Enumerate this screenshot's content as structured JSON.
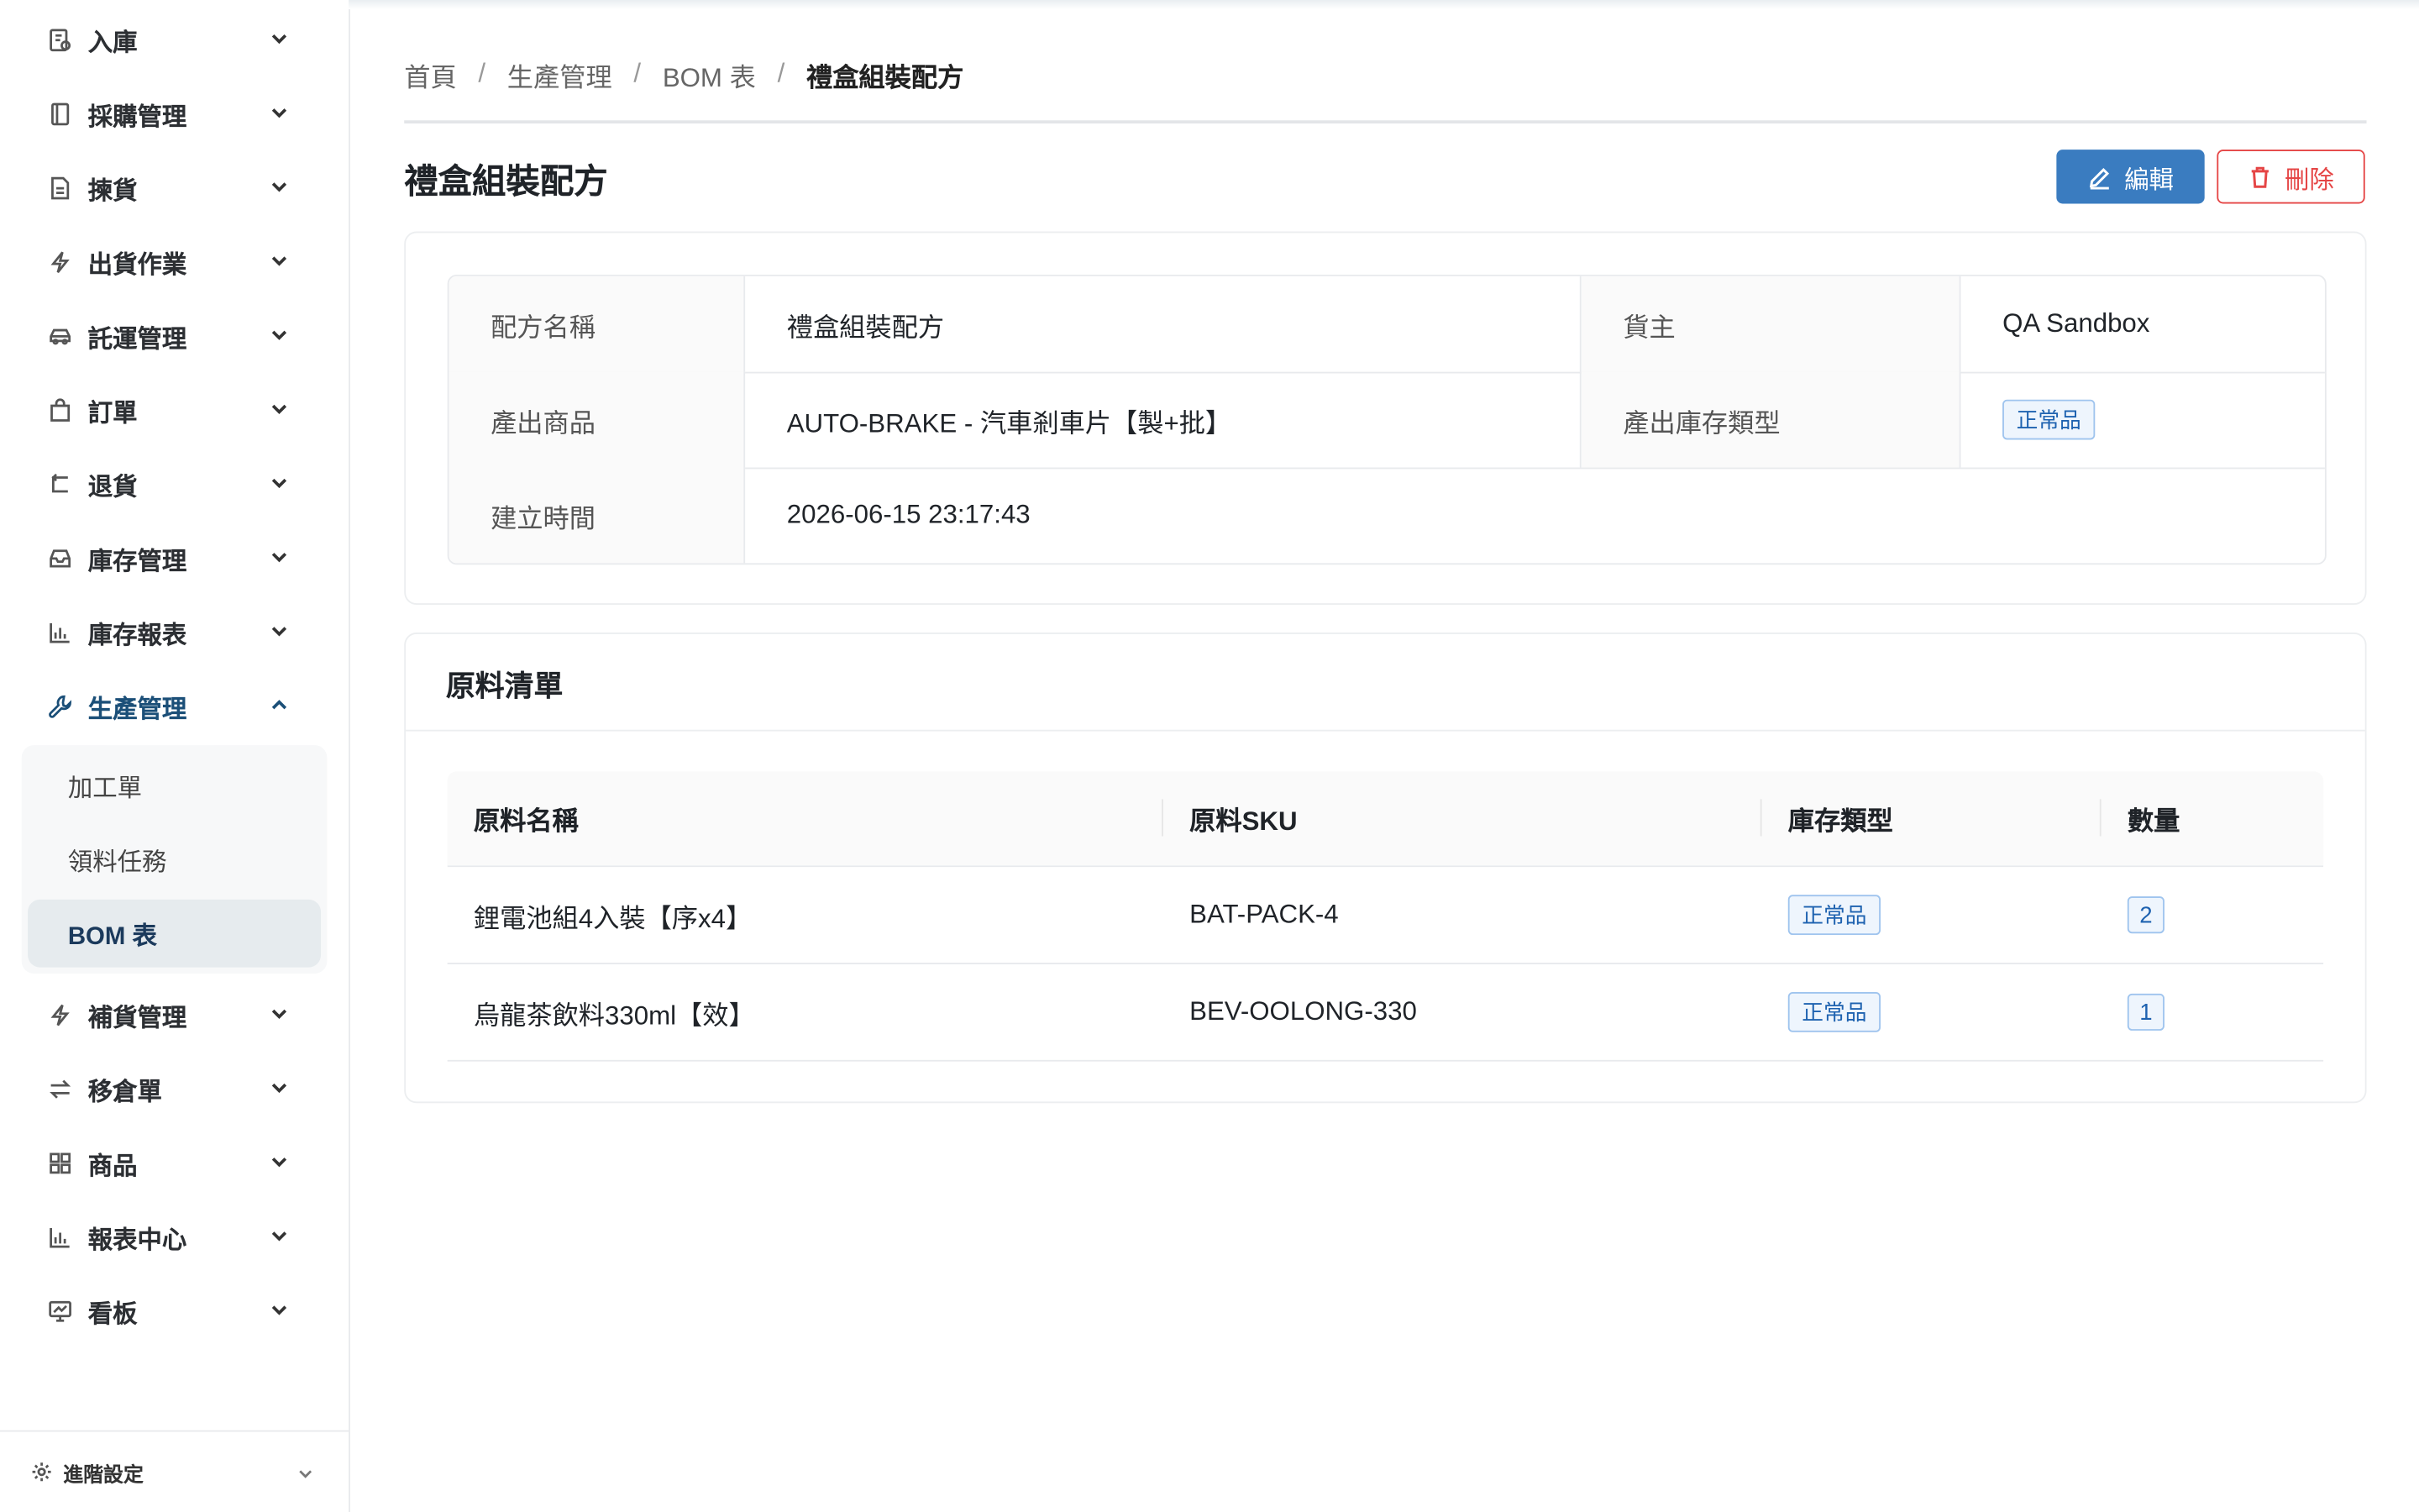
{
  "sidebar": {
    "items": [
      {
        "label": "入庫",
        "icon": "inbound-doc-icon"
      },
      {
        "label": "採購管理",
        "icon": "book-icon"
      },
      {
        "label": "揀貨",
        "icon": "document-icon"
      },
      {
        "label": "出貨作業",
        "icon": "lightning-icon"
      },
      {
        "label": "託運管理",
        "icon": "car-icon"
      },
      {
        "label": "訂單",
        "icon": "shopping-bag-icon"
      },
      {
        "label": "退貨",
        "icon": "return-icon"
      },
      {
        "label": "庫存管理",
        "icon": "inbox-icon"
      },
      {
        "label": "庫存報表",
        "icon": "bar-chart-icon"
      },
      {
        "label": "生產管理",
        "icon": "wrench-icon",
        "expanded": true
      },
      {
        "label": "補貨管理",
        "icon": "lightning-icon"
      },
      {
        "label": "移倉單",
        "icon": "transfer-icon"
      },
      {
        "label": "商品",
        "icon": "grid-icon"
      },
      {
        "label": "報表中心",
        "icon": "bar-chart-icon"
      },
      {
        "label": "看板",
        "icon": "dashboard-icon"
      }
    ],
    "submenu": [
      {
        "label": "加工單"
      },
      {
        "label": "領料任務"
      },
      {
        "label": "BOM 表",
        "selected": true
      }
    ],
    "footer": {
      "label": "進階設定"
    }
  },
  "breadcrumb": {
    "items": [
      "首頁",
      "生產管理",
      "BOM 表"
    ],
    "current": "禮盒組裝配方"
  },
  "page": {
    "title": "禮盒組裝配方",
    "edit_label": "編輯",
    "delete_label": "刪除"
  },
  "info": {
    "recipe_name_label": "配方名稱",
    "recipe_name": "禮盒組裝配方",
    "owner_label": "貨主",
    "owner": "QA Sandbox",
    "output_product_label": "產出商品",
    "output_product": "AUTO-BRAKE - 汽車剎車片【製+批】",
    "output_stock_type_label": "產出庫存類型",
    "output_stock_type": "正常品",
    "created_label": "建立時間",
    "created": "2026-06-15 23:17:43"
  },
  "materials": {
    "title": "原料清單",
    "headers": [
      "原料名稱",
      "原料SKU",
      "庫存類型",
      "數量"
    ],
    "rows": [
      {
        "name": "鋰電池組4入裝【序x4】",
        "sku": "BAT-PACK-4",
        "stock_type": "正常品",
        "qty": "2"
      },
      {
        "name": "烏龍茶飲料330ml【效】",
        "sku": "BEV-OOLONG-330",
        "stock_type": "正常品",
        "qty": "1"
      }
    ]
  },
  "colors": {
    "primary": "#3a7cc0",
    "danger": "#e54545",
    "active_nav": "#1b4f78",
    "tag_text": "#1e62b0"
  }
}
